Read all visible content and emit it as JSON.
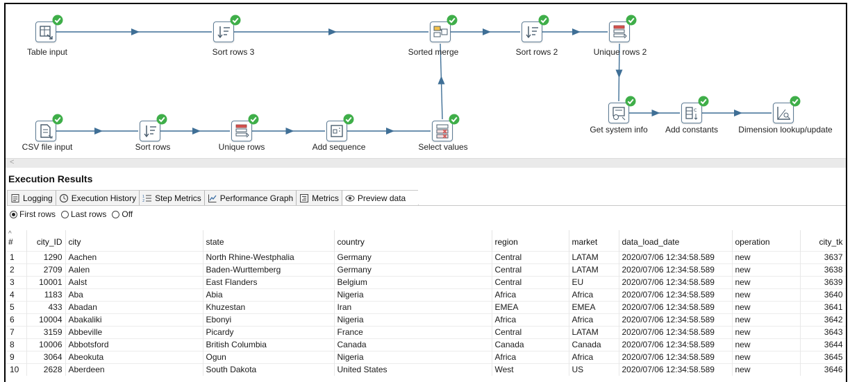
{
  "canvas": {
    "steps": [
      {
        "id": "table_input",
        "label": "Table input",
        "icon": "table-icon"
      },
      {
        "id": "sort_rows_3",
        "label": "Sort rows 3",
        "icon": "sort-icon"
      },
      {
        "id": "sorted_merge",
        "label": "Sorted merge",
        "icon": "merge-icon"
      },
      {
        "id": "sort_rows_2",
        "label": "Sort rows 2",
        "icon": "sort-icon"
      },
      {
        "id": "unique_rows_2",
        "label": "Unique rows 2",
        "icon": "unique-icon"
      },
      {
        "id": "csv_file_input",
        "label": "CSV file input",
        "icon": "file-icon"
      },
      {
        "id": "sort_rows",
        "label": "Sort rows",
        "icon": "sort-icon"
      },
      {
        "id": "unique_rows",
        "label": "Unique rows",
        "icon": "unique-icon"
      },
      {
        "id": "add_sequence",
        "label": "Add sequence",
        "icon": "sequence-icon"
      },
      {
        "id": "select_values",
        "label": "Select values",
        "icon": "select-values-icon"
      },
      {
        "id": "get_system_info",
        "label": "Get system info",
        "icon": "system-info-icon"
      },
      {
        "id": "add_constants",
        "label": "Add constants",
        "icon": "constants-icon"
      },
      {
        "id": "dimension_lookup",
        "label": "Dimension lookup/update",
        "icon": "dimension-icon"
      }
    ],
    "status": "success-check-icon",
    "hop_color": "#3f6f96",
    "check_color": "#3fae49",
    "scroll_arrow": "<"
  },
  "results": {
    "title": "Execution Results",
    "tabs": [
      {
        "label": "Logging",
        "icon": "log-icon"
      },
      {
        "label": "Execution History",
        "icon": "history-icon"
      },
      {
        "label": "Step Metrics",
        "icon": "metrics-list-icon"
      },
      {
        "label": "Performance Graph",
        "icon": "graph-icon"
      },
      {
        "label": "Metrics",
        "icon": "metrics-icon"
      },
      {
        "label": "Preview data",
        "icon": "eye-icon",
        "active": true
      }
    ],
    "radios": [
      {
        "label": "First rows",
        "selected": true
      },
      {
        "label": "Last rows",
        "selected": false
      },
      {
        "label": "Off",
        "selected": false
      }
    ]
  },
  "table": {
    "sort_glyph": "^",
    "columns": [
      "#",
      "city_ID",
      "city",
      "state",
      "country",
      "region",
      "market",
      "data_load_date",
      "operation",
      "city_tk"
    ],
    "rows": [
      [
        "1",
        "1290",
        "Aachen",
        "North Rhine-Westphalia",
        "Germany",
        "Central",
        "LATAM",
        "2020/07/06 12:34:58.589",
        "new",
        "3637"
      ],
      [
        "2",
        "2709",
        "Aalen",
        "Baden-Wurttemberg",
        "Germany",
        "Central",
        "LATAM",
        "2020/07/06 12:34:58.589",
        "new",
        "3638"
      ],
      [
        "3",
        "10001",
        "Aalst",
        "East Flanders",
        "Belgium",
        "Central",
        "EU",
        "2020/07/06 12:34:58.589",
        "new",
        "3639"
      ],
      [
        "4",
        "1183",
        "Aba",
        "Abia",
        "Nigeria",
        "Africa",
        "Africa",
        "2020/07/06 12:34:58.589",
        "new",
        "3640"
      ],
      [
        "5",
        "433",
        "Abadan",
        "Khuzestan",
        "Iran",
        "EMEA",
        "EMEA",
        "2020/07/06 12:34:58.589",
        "new",
        "3641"
      ],
      [
        "6",
        "10004",
        "Abakaliki",
        "Ebonyi",
        "Nigeria",
        "Africa",
        "Africa",
        "2020/07/06 12:34:58.589",
        "new",
        "3642"
      ],
      [
        "7",
        "3159",
        "Abbeville",
        "Picardy",
        "France",
        "Central",
        "LATAM",
        "2020/07/06 12:34:58.589",
        "new",
        "3643"
      ],
      [
        "8",
        "10006",
        "Abbotsford",
        "British Columbia",
        "Canada",
        "Canada",
        "Canada",
        "2020/07/06 12:34:58.589",
        "new",
        "3644"
      ],
      [
        "9",
        "3064",
        "Abeokuta",
        "Ogun",
        "Nigeria",
        "Africa",
        "Africa",
        "2020/07/06 12:34:58.589",
        "new",
        "3645"
      ],
      [
        "10",
        "2628",
        "Aberdeen",
        "South Dakota",
        "United States",
        "West",
        "US",
        "2020/07/06 12:34:58.589",
        "new",
        "3646"
      ]
    ]
  }
}
